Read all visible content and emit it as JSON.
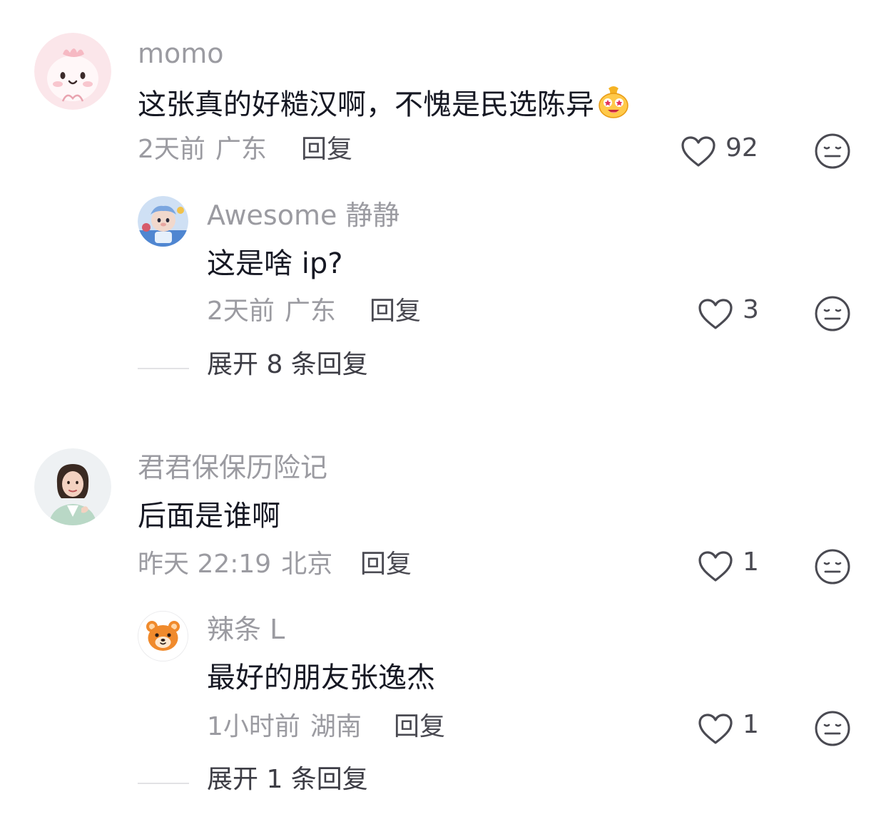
{
  "comments": [
    {
      "user": "momo",
      "text": "这张真的好糙汉啊，不愧是民选陈异",
      "time": "2天前",
      "location": "广东",
      "reply_label": "回复",
      "likes": "92",
      "replies": [
        {
          "user": "Awesome 静静",
          "text": "这是啥 ip?",
          "time": "2天前",
          "location": "广东",
          "reply_label": "回复",
          "likes": "3"
        }
      ],
      "expand_label": "展开 8 条回复"
    },
    {
      "user": "君君保保历险记",
      "text": "后面是谁啊",
      "time": "昨天 22:19",
      "location": "北京",
      "reply_label": "回复",
      "likes": "1",
      "replies": [
        {
          "user": "辣条 L",
          "text": "最好的朋友张逸杰",
          "time": "1小时前",
          "location": "湖南",
          "reply_label": "回复",
          "likes": "1"
        }
      ],
      "expand_label": "展开 1 条回复"
    }
  ],
  "icons": {
    "like": "heart-outline-icon",
    "dislike": "meh-face-icon",
    "emoji": "money-bag-face-emoji"
  },
  "colors": {
    "text": "#161823",
    "muted": "#9b9ba1",
    "action": "#4a4a52",
    "background": "#ffffff"
  }
}
